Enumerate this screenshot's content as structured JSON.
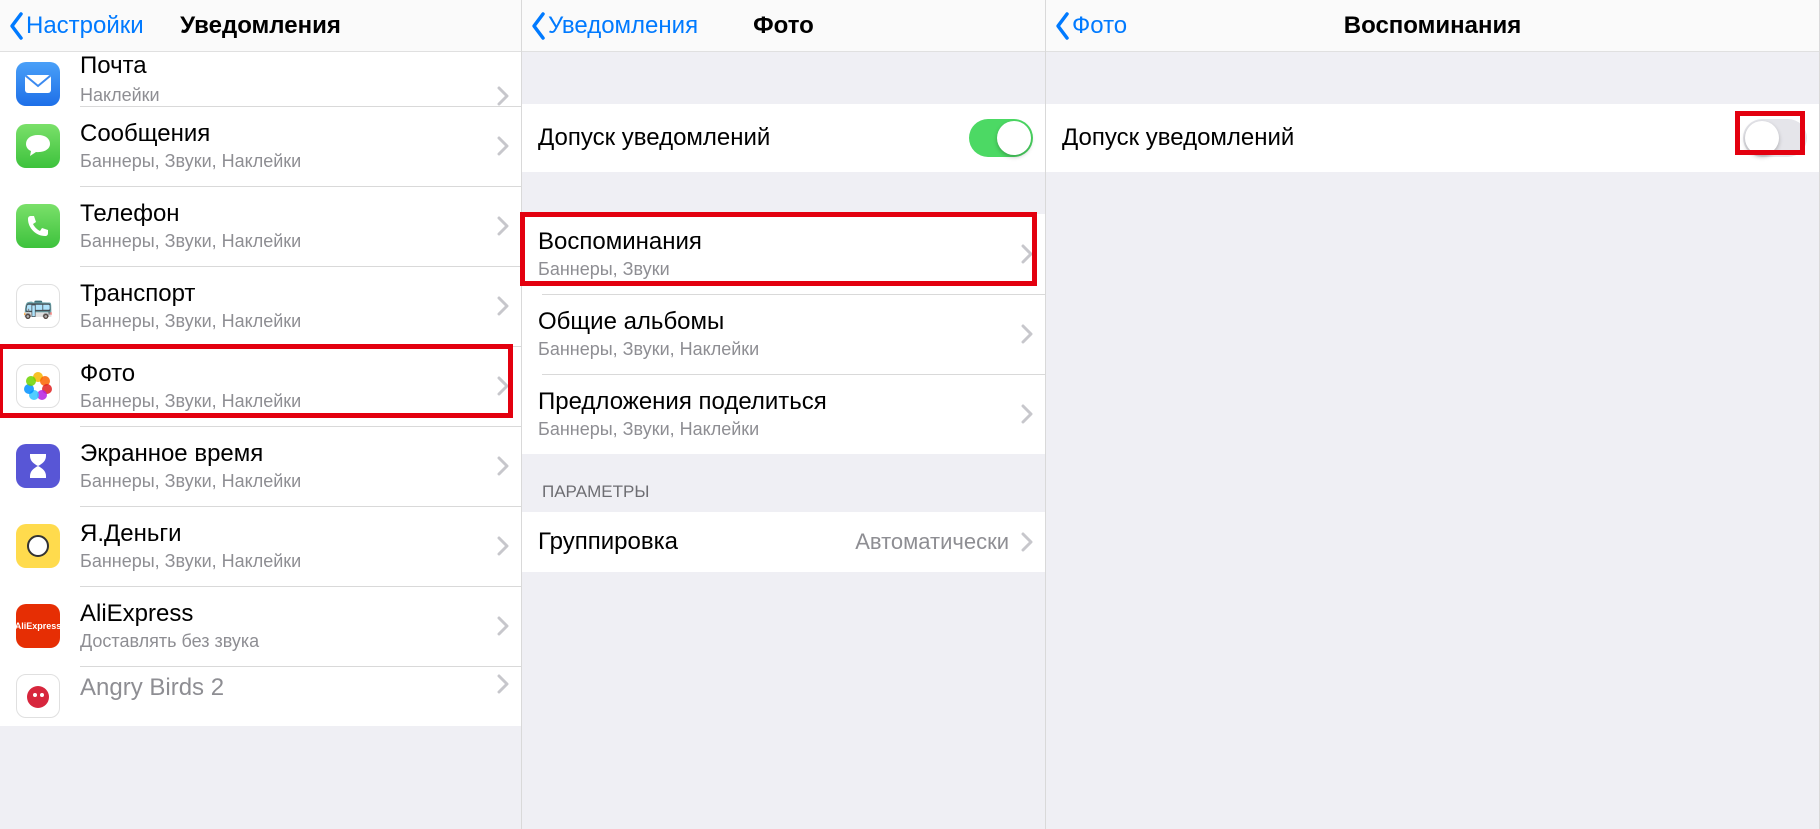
{
  "panel1": {
    "back": "Настройки",
    "title": "Уведомления",
    "items": [
      {
        "id": "mail",
        "title": "Почта",
        "sub": "Наклейки"
      },
      {
        "id": "messages",
        "title": "Сообщения",
        "sub": "Баннеры, Звуки, Наклейки"
      },
      {
        "id": "phone",
        "title": "Телефон",
        "sub": "Баннеры, Звуки, Наклейки"
      },
      {
        "id": "transport",
        "title": "Транспорт",
        "sub": "Баннеры, Звуки, Наклейки"
      },
      {
        "id": "photos",
        "title": "Фото",
        "sub": "Баннеры, Звуки, Наклейки",
        "highlight": true
      },
      {
        "id": "screentime",
        "title": "Экранное время",
        "sub": "Баннеры, Звуки, Наклейки"
      },
      {
        "id": "yadenghi",
        "title": "Я.Деньги",
        "sub": "Баннеры, Звуки, Наклейки"
      },
      {
        "id": "ali",
        "title": "AliExpress",
        "sub": "Доставлять без звука"
      },
      {
        "id": "angry",
        "title": "Angry Birds 2",
        "sub": ""
      }
    ]
  },
  "panel2": {
    "back": "Уведомления",
    "title": "Фото",
    "allow_label": "Допуск уведомлений",
    "allow_on": true,
    "group1": [
      {
        "id": "memories",
        "title": "Воспоминания",
        "sub": "Баннеры, Звуки",
        "highlight": true
      },
      {
        "id": "shared",
        "title": "Общие альбомы",
        "sub": "Баннеры, Звуки, Наклейки"
      },
      {
        "id": "sharesug",
        "title": "Предложения поделиться",
        "sub": "Баннеры, Звуки, Наклейки"
      }
    ],
    "section_params": "ПАРАМЕТРЫ",
    "grouping_label": "Группировка",
    "grouping_value": "Автоматически"
  },
  "panel3": {
    "back": "Фото",
    "title": "Воспоминания",
    "allow_label": "Допуск уведомлений",
    "allow_on": false,
    "highlight_toggle": true
  }
}
